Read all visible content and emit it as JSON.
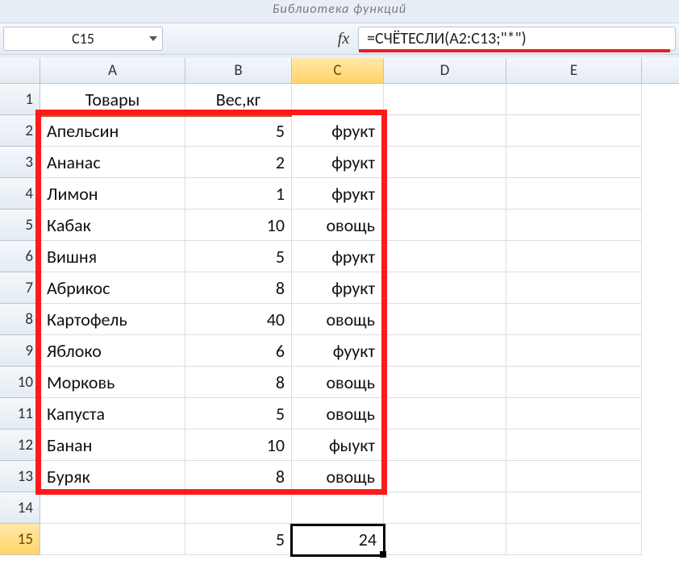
{
  "ribbon_group": "Библиотека функций",
  "name_box": "C15",
  "fx_label": "fx",
  "formula": "=СЧЁТЕСЛИ(A2:C13;\"*\")",
  "columns": [
    "A",
    "B",
    "C",
    "D",
    "E"
  ],
  "selected_col": "C",
  "selected_row": 15,
  "headers": {
    "A": "Товары",
    "B": "Вес,кг",
    "C": ""
  },
  "rows": [
    {
      "n": 2,
      "A": "Апельсин",
      "B": 5,
      "C": "фрукт"
    },
    {
      "n": 3,
      "A": "Ананас",
      "B": 2,
      "C": "фрукт"
    },
    {
      "n": 4,
      "A": "Лимон",
      "B": 1,
      "C": "фрукт"
    },
    {
      "n": 5,
      "A": "Кабак",
      "B": 10,
      "C": "овощь"
    },
    {
      "n": 6,
      "A": "Вишня",
      "B": 5,
      "C": "фрукт"
    },
    {
      "n": 7,
      "A": "Абрикос",
      "B": 8,
      "C": "фрукт"
    },
    {
      "n": 8,
      "A": "Картофель",
      "B": 40,
      "C": "овощь"
    },
    {
      "n": 9,
      "A": "Яблоко",
      "B": 6,
      "C": "фуукт"
    },
    {
      "n": 10,
      "A": "Морковь",
      "B": 8,
      "C": "овощь"
    },
    {
      "n": 11,
      "A": "Капуста",
      "B": 5,
      "C": "овощь"
    },
    {
      "n": 12,
      "A": "Банан",
      "B": 10,
      "C": "фыукт"
    },
    {
      "n": 13,
      "A": "Буряк",
      "B": 8,
      "C": "овощь"
    }
  ],
  "row14": {
    "A": "",
    "B": "",
    "C": ""
  },
  "row15": {
    "A": "",
    "B": 5,
    "C": 24
  }
}
